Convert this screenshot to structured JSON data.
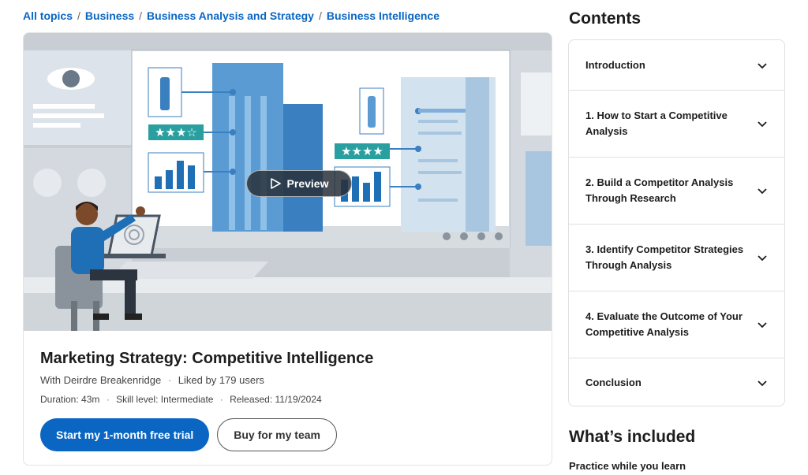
{
  "breadcrumbs": [
    "All topics",
    "Business",
    "Business Analysis and Strategy",
    "Business Intelligence"
  ],
  "breadcrumb_sep": "/",
  "hero": {
    "preview_label": "Preview",
    "rating_left": "★★★☆",
    "rating_right": "★★★★"
  },
  "course": {
    "title": "Marketing Strategy: Competitive Intelligence",
    "author": "With Deirdre Breakenridge",
    "likes": "Liked by 179 users",
    "duration": "Duration: 43m",
    "skill": "Skill level: Intermediate",
    "released": "Released: 11/19/2024",
    "dot": "·"
  },
  "buttons": {
    "trial": "Start my 1-month free trial",
    "team": "Buy for my team"
  },
  "contents": {
    "heading": "Contents",
    "items": [
      "Introduction",
      "1. How to Start a Competitive Analysis",
      "2. Build a Competitor Analysis Through Research",
      "3. Identify Competitor Strategies Through Analysis",
      "4. Evaluate the Outcome of Your Competitive Analysis",
      "Conclusion"
    ]
  },
  "included": {
    "heading": "What’s included",
    "first_item": "Practice while you learn"
  },
  "colors": {
    "accent": "#0a66c2",
    "hero_blue": "#4a90c9",
    "hero_light": "#c7cdd3"
  }
}
